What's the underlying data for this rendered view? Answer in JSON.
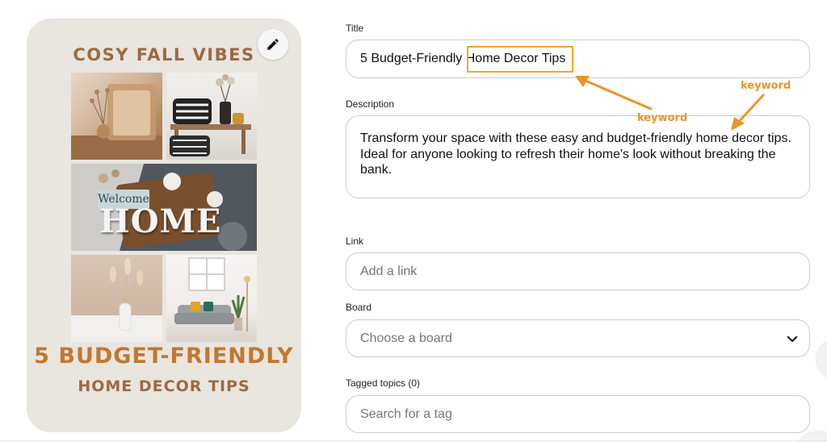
{
  "pin": {
    "header": "COSY FALL VIBES",
    "welcome_sign": "Welcome",
    "home_sign": "HOME",
    "bottom_title": "5 BUDGET-FRIENDLY",
    "bottom_subtitle": "HOME DECOR TIPS",
    "edit_icon": "pencil-icon"
  },
  "form": {
    "title": {
      "label": "Title",
      "value_prefix": "5 Budget-Friendly ",
      "value_highlight": "Home Decor Tips"
    },
    "description": {
      "label": "Description",
      "value": "Transform your space with these easy and budget-friendly home decor tips. Ideal for anyone looking to refresh their home's look without breaking the bank."
    },
    "link": {
      "label": "Link",
      "placeholder": "Add a link"
    },
    "board": {
      "label": "Board",
      "placeholder": "Choose a board",
      "icon": "chevron-down-icon"
    },
    "tagged_topics": {
      "label": "Tagged topics (0)",
      "placeholder": "Search for a tag"
    }
  },
  "annotations": {
    "keyword_1": "keyword",
    "keyword_2": "keyword",
    "color": "#e8952a"
  },
  "colors": {
    "card_bg": "#e9e5df",
    "pin_brown": "#9c6a43",
    "pin_orange": "#c3772f"
  }
}
